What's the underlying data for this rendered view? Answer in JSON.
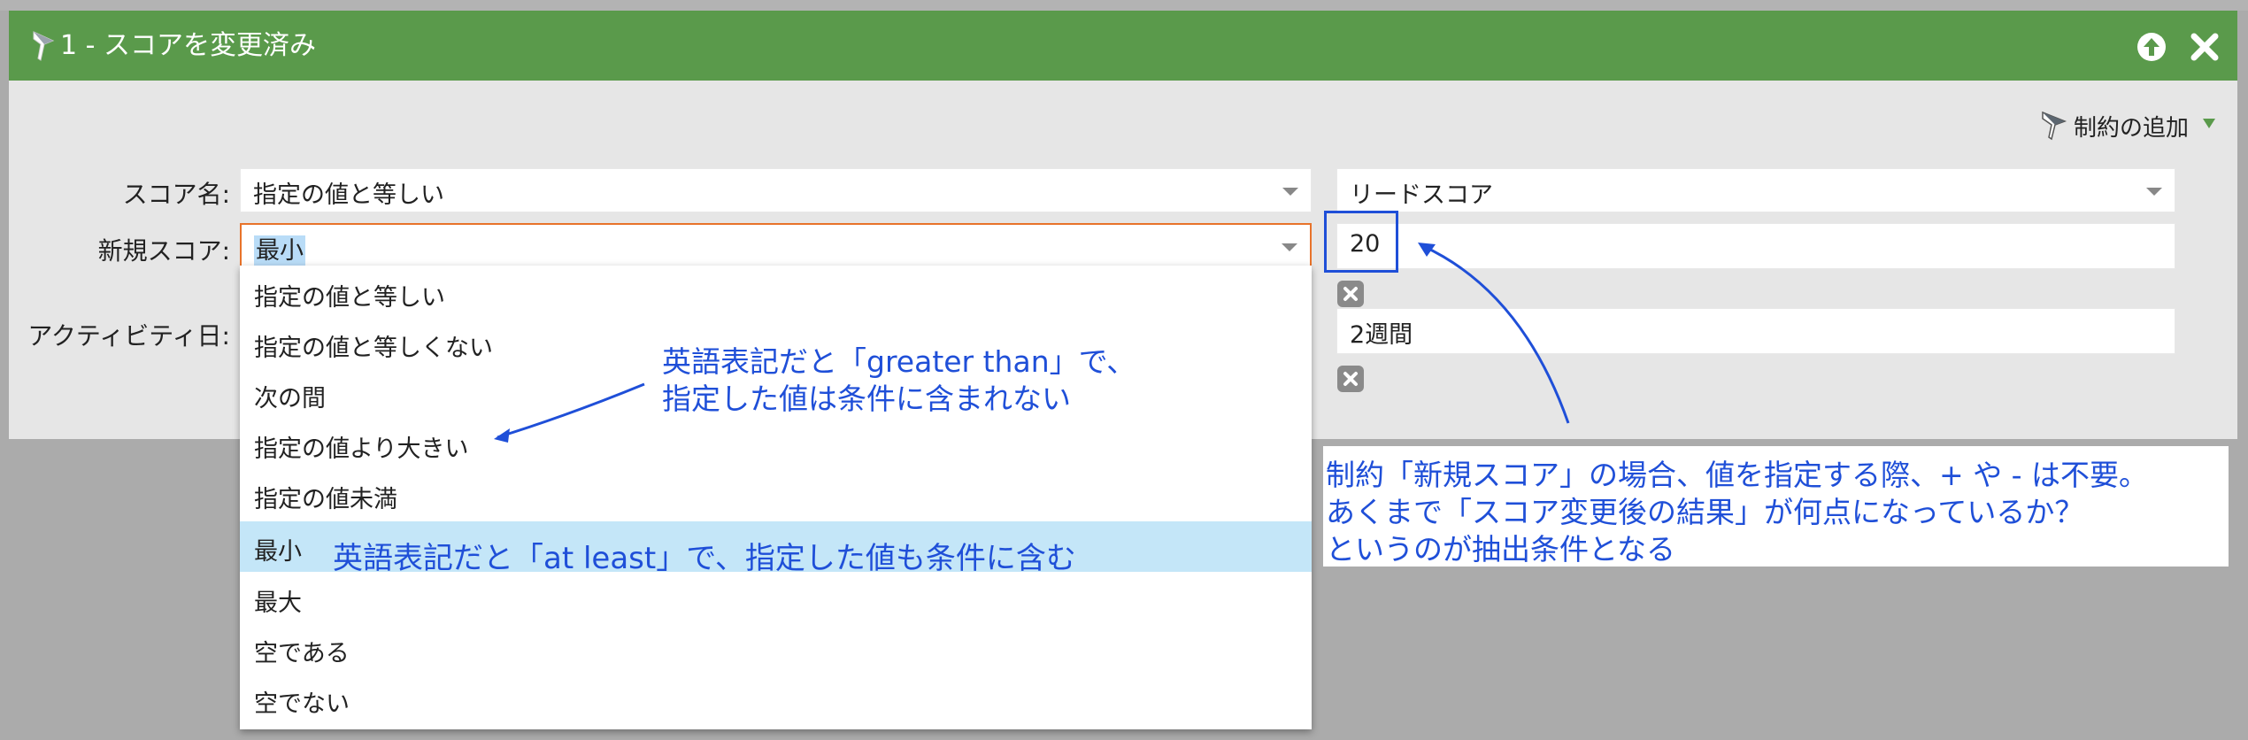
{
  "header": {
    "title": "1 - スコアを変更済み",
    "icons": [
      "filter-icon",
      "collapse-up-icon",
      "close-icon"
    ]
  },
  "toolbar": {
    "add_constraint_label": "制約の追加"
  },
  "form": {
    "score_name": {
      "label": "スコア名:",
      "operator": "指定の値と等しい",
      "value": "リードスコア"
    },
    "new_score": {
      "label": "新規スコア:",
      "operator": "最小",
      "value": "20"
    },
    "activity_date": {
      "label": "アクティビティ日:",
      "value": "2週間"
    }
  },
  "dropdown": {
    "selected": "最小",
    "options": [
      "指定の値と等しい",
      "指定の値と等しくない",
      "次の間",
      "指定の値より大きい",
      "指定の値未満",
      "最小",
      "最大",
      "空である",
      "空でない"
    ]
  },
  "annotations": {
    "greater_than_note": [
      "英語表記だと「greater than」で、",
      "指定した値は条件に含まれない"
    ],
    "at_least_note": "英語表記だと「at least」で、指定した値も条件に含む",
    "new_score_note": [
      "制約「新規スコア」の場合、値を指定する際、+ や - は不要。",
      "あくまで「スコア変更後の結果」が何点になっているか？",
      "というのが抽出条件となる"
    ],
    "color": "#1f4fd8"
  },
  "colors": {
    "header_green": "#5a9a4b",
    "focus_orange": "#e8732a",
    "selection_blue": "#c4e6f8"
  }
}
